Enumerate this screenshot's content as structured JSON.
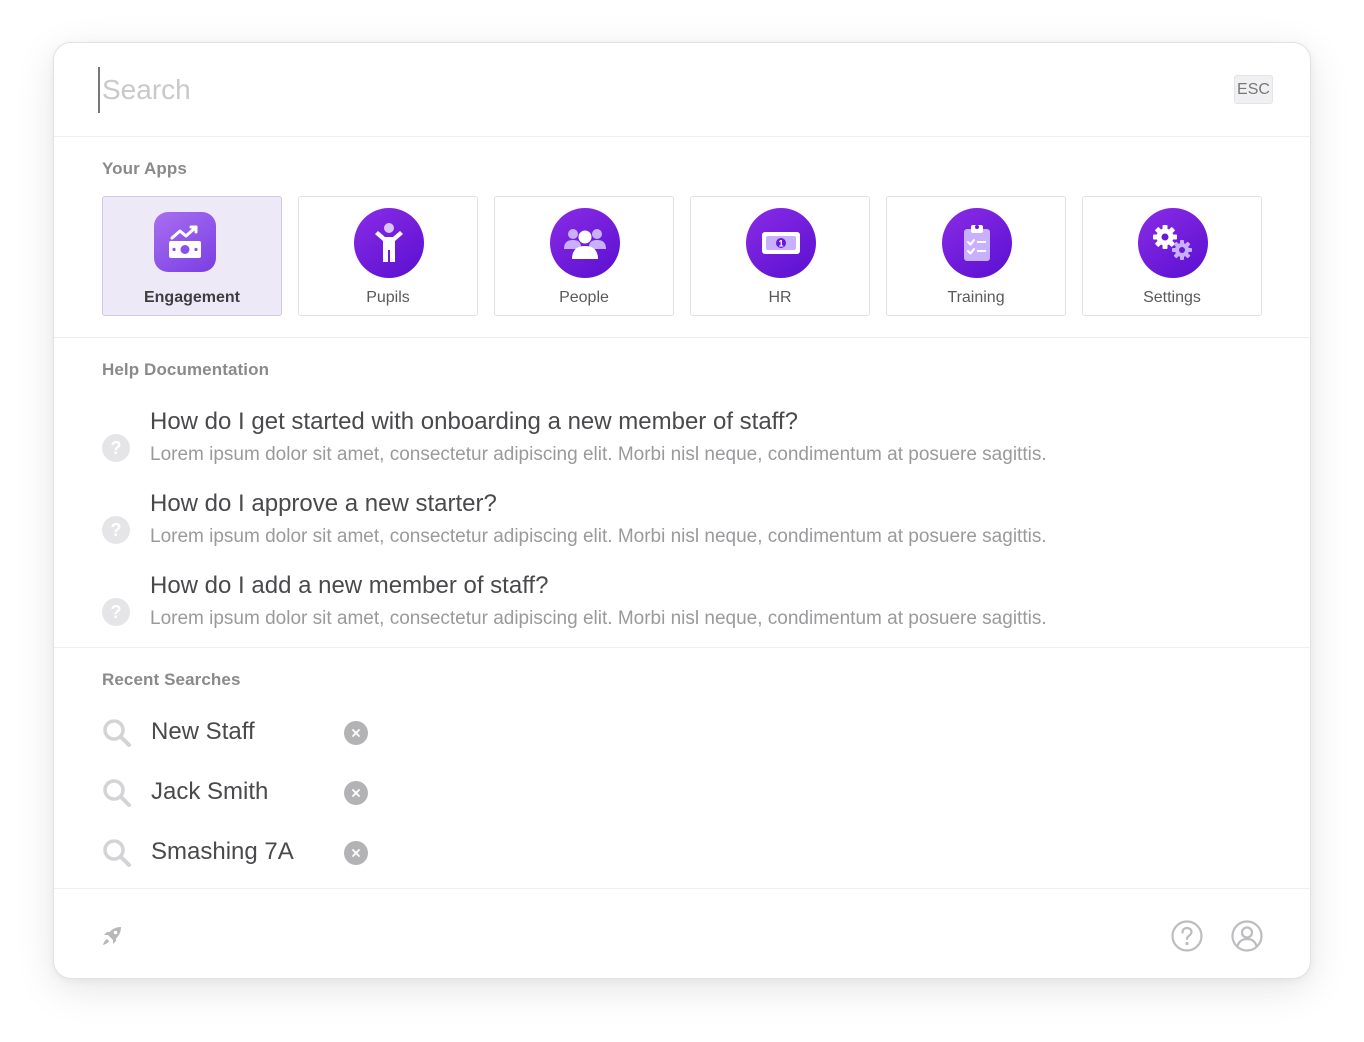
{
  "search": {
    "placeholder": "Search",
    "esc_label": "ESC"
  },
  "apps": {
    "title": "Your Apps",
    "items": [
      {
        "label": "Engagement",
        "icon": "engagement-icon",
        "active": true
      },
      {
        "label": "Pupils",
        "icon": "pupil-icon",
        "active": false
      },
      {
        "label": "People",
        "icon": "people-icon",
        "active": false
      },
      {
        "label": "HR",
        "icon": "money-icon",
        "active": false
      },
      {
        "label": "Training",
        "icon": "clipboard-icon",
        "active": false
      },
      {
        "label": "Settings",
        "icon": "gears-icon",
        "active": false
      }
    ]
  },
  "help": {
    "title": "Help Documentation",
    "items": [
      {
        "question": "How do I get started with onboarding a new member of staff?",
        "answer": "Lorem ipsum dolor sit amet, consectetur adipiscing elit. Morbi nisl neque, condimentum at posuere sagittis."
      },
      {
        "question": "How do I approve a new starter?",
        "answer": "Lorem ipsum dolor sit amet, consectetur adipiscing elit. Morbi nisl neque, condimentum at posuere sagittis."
      },
      {
        "question": "How do I add a new member of staff?",
        "answer": "Lorem ipsum dolor sit amet, consectetur adipiscing elit. Morbi nisl neque, condimentum at posuere sagittis."
      }
    ],
    "icon_glyph": "?"
  },
  "recent": {
    "title": "Recent Searches",
    "items": [
      {
        "label": "New Staff"
      },
      {
        "label": "Jack Smith"
      },
      {
        "label": "Smashing 7A"
      }
    ]
  },
  "colors": {
    "accent_purple": "#6a17d9",
    "accent_light": "#ede9f7",
    "muted_text": "#9a9a9d"
  }
}
